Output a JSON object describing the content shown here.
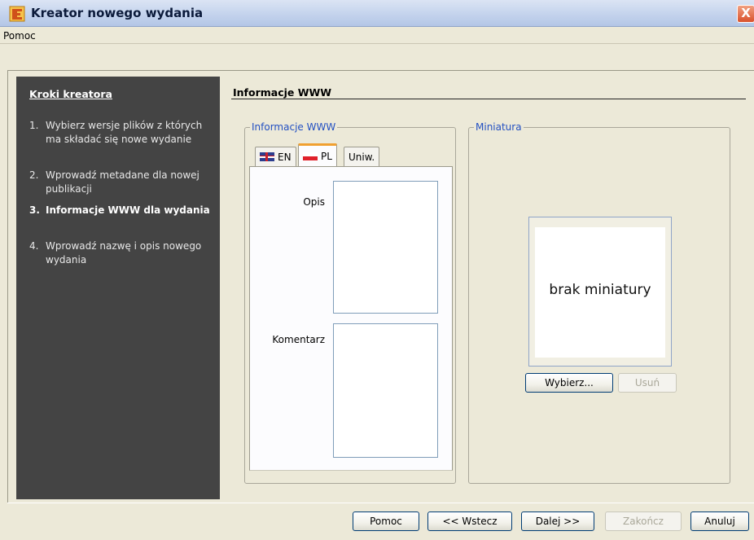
{
  "window": {
    "title": "Kreator nowego wydania",
    "close_glyph": "X"
  },
  "menu": {
    "help": "Pomoc"
  },
  "sidebar": {
    "title": "Kroki kreatora",
    "steps": [
      {
        "num": "1.",
        "label": "Wybierz wersje plików z których ma składać się nowe wydanie"
      },
      {
        "num": "2.",
        "label": "Wprowadź metadane dla nowej publikacji"
      },
      {
        "num": "3.",
        "label": "Informacje WWW dla wydania",
        "active": true
      },
      {
        "num": "4.",
        "label": "Wprowadź nazwę i opis nowego wydania"
      }
    ]
  },
  "main": {
    "heading": "Informacje WWW",
    "www_group": {
      "title": "Informacje WWW",
      "tabs": [
        {
          "label": "EN",
          "icon": "flag-en-icon"
        },
        {
          "label": "PL",
          "icon": "flag-pl-icon",
          "selected": true
        },
        {
          "label": "Uniw."
        }
      ],
      "description_label": "Opis",
      "description_value": "",
      "comment_label": "Komentarz",
      "comment_value": ""
    },
    "thumbnail_group": {
      "title": "Miniatura",
      "placeholder": "brak miniatury",
      "choose_button": "Wybierz...",
      "remove_button": "Usuń"
    }
  },
  "footer": {
    "help_button": "Pomoc",
    "back_button": "<< Wstecz",
    "next_button": "Dalej >>",
    "finish_button": "Zakończ",
    "cancel_button": "Anuluj"
  },
  "colors": {
    "sidebar_bg": "#444444",
    "group_title": "#2350c2",
    "selected_tab_accent": "#f0a030"
  }
}
